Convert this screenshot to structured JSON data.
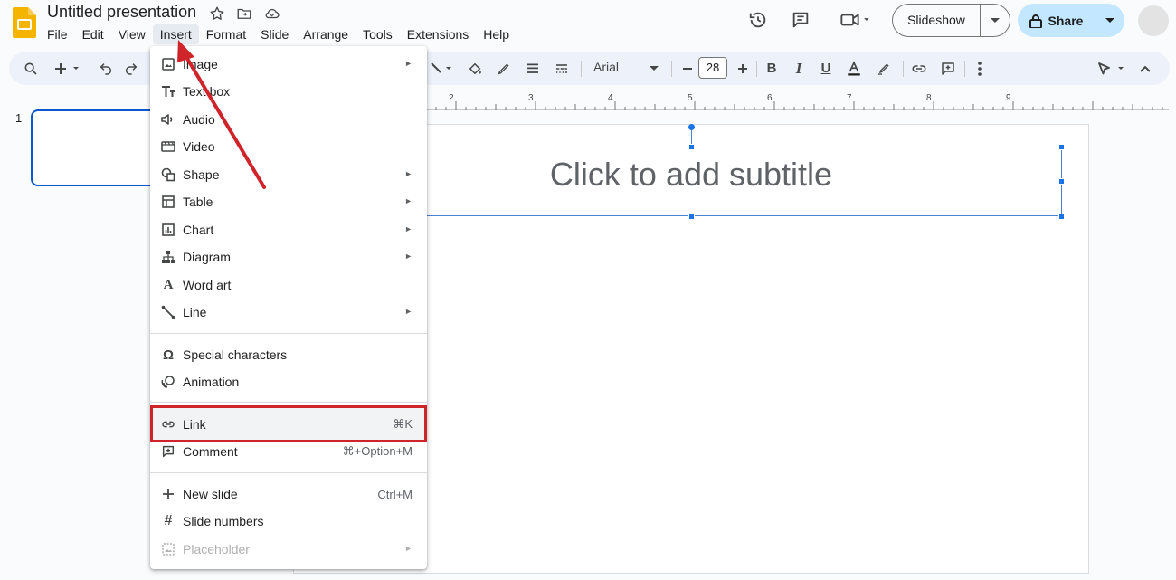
{
  "app": {
    "title": "Untitled presentation",
    "menu": [
      "File",
      "Edit",
      "View",
      "Insert",
      "Format",
      "Slide",
      "Arrange",
      "Tools",
      "Extensions",
      "Help"
    ],
    "active_menu": "Insert"
  },
  "header": {
    "slideshow_label": "Slideshow",
    "share_label": "Share"
  },
  "toolbar": {
    "font_name": "Arial",
    "font_size": "28"
  },
  "ruler": {
    "ticks": [
      "2",
      "3",
      "4",
      "5",
      "6",
      "7",
      "8",
      "9"
    ]
  },
  "slides_panel": {
    "slide_number": "1"
  },
  "canvas": {
    "subtitle_placeholder": "Click to add subtitle"
  },
  "insert_menu": {
    "items": [
      {
        "label": "Image",
        "icon": "image-icon",
        "submenu": true
      },
      {
        "label": "Text box",
        "icon": "text-box-icon"
      },
      {
        "label": "Audio",
        "icon": "audio-icon"
      },
      {
        "label": "Video",
        "icon": "video-icon"
      },
      {
        "label": "Shape",
        "icon": "shape-icon",
        "submenu": true
      },
      {
        "label": "Table",
        "icon": "table-icon",
        "submenu": true
      },
      {
        "label": "Chart",
        "icon": "chart-icon",
        "submenu": true
      },
      {
        "label": "Diagram",
        "icon": "diagram-icon",
        "submenu": true
      },
      {
        "label": "Word art",
        "icon": "word-art-icon"
      },
      {
        "label": "Line",
        "icon": "line-icon",
        "submenu": true
      },
      {
        "label": "Special characters",
        "icon": "omega-icon"
      },
      {
        "label": "Animation",
        "icon": "animation-icon"
      },
      {
        "label": "Link",
        "icon": "link-icon",
        "shortcut": "⌘K",
        "highlighted": true
      },
      {
        "label": "Comment",
        "icon": "comment-icon",
        "shortcut": "⌘+Option+M"
      },
      {
        "label": "New slide",
        "icon": "plus-icon",
        "shortcut": "Ctrl+M"
      },
      {
        "label": "Slide numbers",
        "icon": "hash-icon"
      },
      {
        "label": "Placeholder",
        "icon": "placeholder-icon",
        "submenu": true,
        "disabled": true
      }
    ]
  },
  "annotation": {
    "highlight_color": "#d0242b",
    "arrow_color": "#d0242b"
  },
  "colors": {
    "accent": "#0b57d0",
    "share_bg": "#c2e7ff",
    "toolbar_bg": "#edf2fa"
  }
}
